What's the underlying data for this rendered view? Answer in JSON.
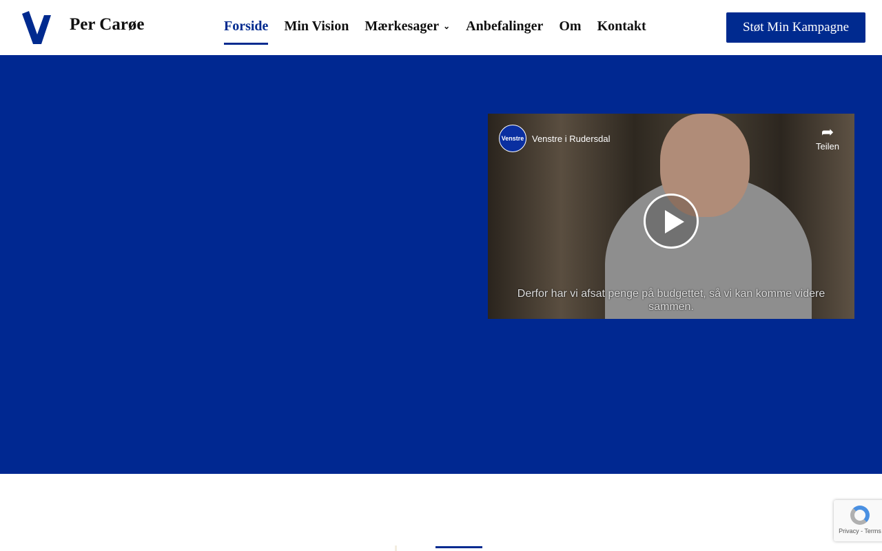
{
  "header": {
    "brand": "Per Carøe",
    "logo_letter": "V",
    "nav": [
      {
        "label": "Forside",
        "active": true
      },
      {
        "label": "Min Vision"
      },
      {
        "label": "Mærkesager",
        "dropdown": true
      },
      {
        "label": "Anbefalinger"
      },
      {
        "label": "Om"
      },
      {
        "label": "Kontakt"
      }
    ],
    "cta": "Støt Min Kampagne"
  },
  "colors": {
    "brand": "#002a8f",
    "hero": "#002891"
  },
  "video": {
    "channel": "Venstre i Rudersdal",
    "channel_logo": "Venstre",
    "share_label": "Teilen",
    "subtitle": "Derfor har vi afsat penge på budgettet, så vi kan komme videre sammen."
  },
  "recaptcha": {
    "links": "Privacy - Terms"
  }
}
